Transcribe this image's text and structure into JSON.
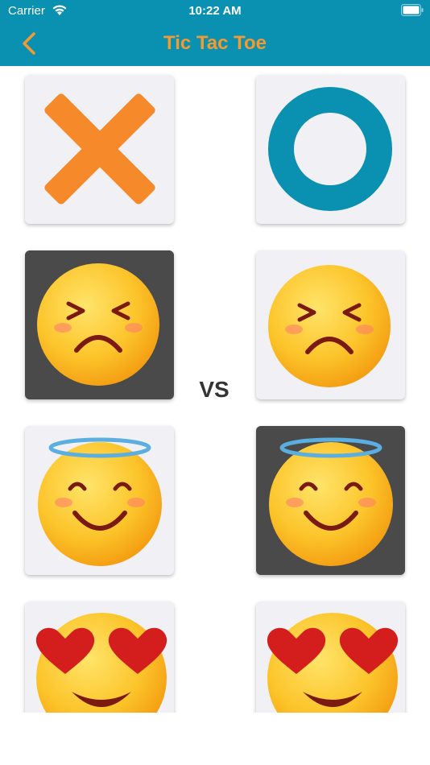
{
  "status_bar": {
    "carrier": "Carrier",
    "time": "10:22 AM"
  },
  "nav": {
    "title": "Tic Tac Toe"
  },
  "vs_label": "VS",
  "colors": {
    "header": "#0a90b0",
    "accent": "#f39a33",
    "x_mark": "#f68a2a",
    "o_mark": "#0a90b0",
    "tile": "#f1f1f5",
    "tile_selected": "#4a4a4a"
  },
  "player1_options": [
    {
      "icon": "x-mark-icon",
      "selected": false
    },
    {
      "icon": "squinting-sad-emoji-icon",
      "selected": true
    },
    {
      "icon": "angel-smile-emoji-icon",
      "selected": false
    },
    {
      "icon": "heart-eyes-emoji-icon",
      "selected": false
    }
  ],
  "player2_options": [
    {
      "icon": "o-mark-icon",
      "selected": false
    },
    {
      "icon": "squinting-sad-emoji-icon",
      "selected": false
    },
    {
      "icon": "angel-smile-emoji-icon",
      "selected": true
    },
    {
      "icon": "heart-eyes-emoji-icon",
      "selected": false
    }
  ]
}
